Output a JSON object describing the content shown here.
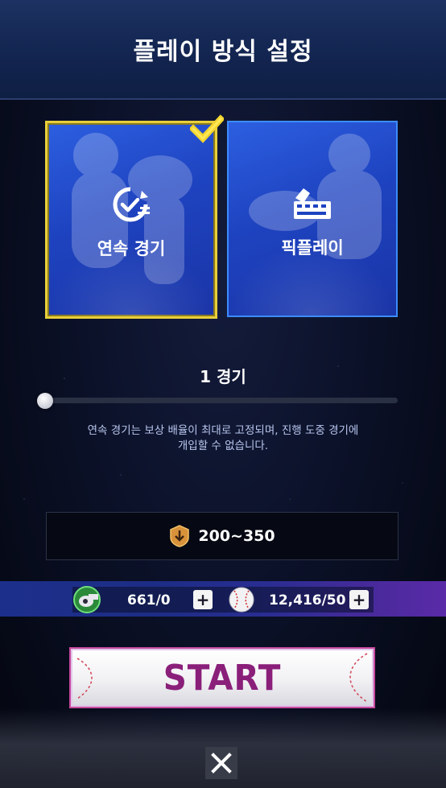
{
  "header": {
    "title": "플레이 방식 설정"
  },
  "modes": [
    {
      "label": "연속 경기",
      "selected": true,
      "icon": "auto-play-icon"
    },
    {
      "label": "픽플레이",
      "selected": false,
      "icon": "pick-play-icon"
    }
  ],
  "games": {
    "label": "1 경기",
    "slider_value": 1
  },
  "description": {
    "line1": "연속 경기는 보상 배율이 최대로 고정되며, 진행 도중 경기에",
    "line2": "개입할 수 없습니다."
  },
  "reward": {
    "text": "200~350",
    "icon": "reward-badge-icon"
  },
  "resources": {
    "whistle": {
      "value": "661/0",
      "icon": "whistle-icon"
    },
    "baseball": {
      "value": "12,416/50",
      "icon": "baseball-icon"
    },
    "plus_label": "+"
  },
  "start": {
    "label": "START"
  },
  "close": {
    "label": "✕"
  },
  "colors": {
    "selected_border": "#e8cf3a",
    "card_blue": "#1e43c0",
    "start_text": "#8a1f7a"
  }
}
